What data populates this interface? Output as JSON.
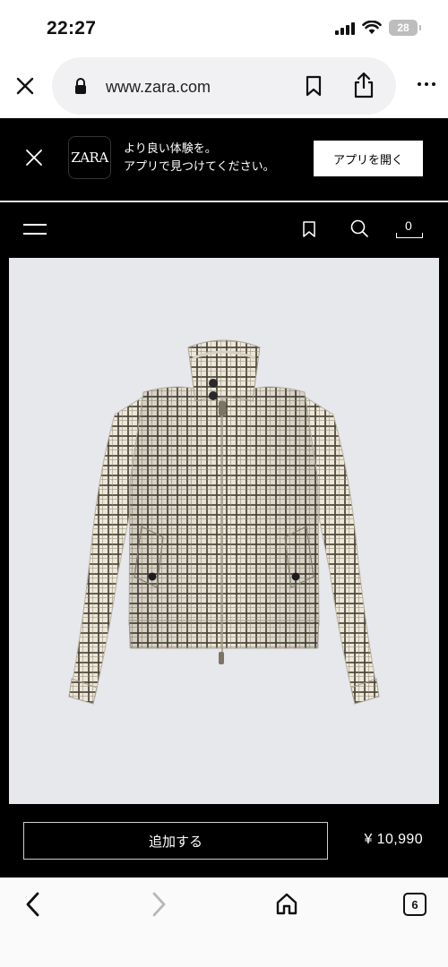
{
  "status": {
    "time": "22:27",
    "battery": "28"
  },
  "browser": {
    "url": "www.zara.com"
  },
  "app_banner": {
    "logo_text": "ZARA",
    "line1": "より良い体験を。",
    "line2": "アプリで見つけてください。",
    "open_button": "アプリを開く"
  },
  "nav": {
    "cart_count": "0"
  },
  "product": {
    "image_alt": "checked cropped jacket",
    "add_button": "追加する",
    "price": "¥ 10,990"
  },
  "toolbar": {
    "tab_count": "6"
  },
  "colors": {
    "black": "#000000",
    "photo_bg": "#e6e8ec",
    "fabric": "#ece7d9",
    "check": "#4a4438"
  }
}
